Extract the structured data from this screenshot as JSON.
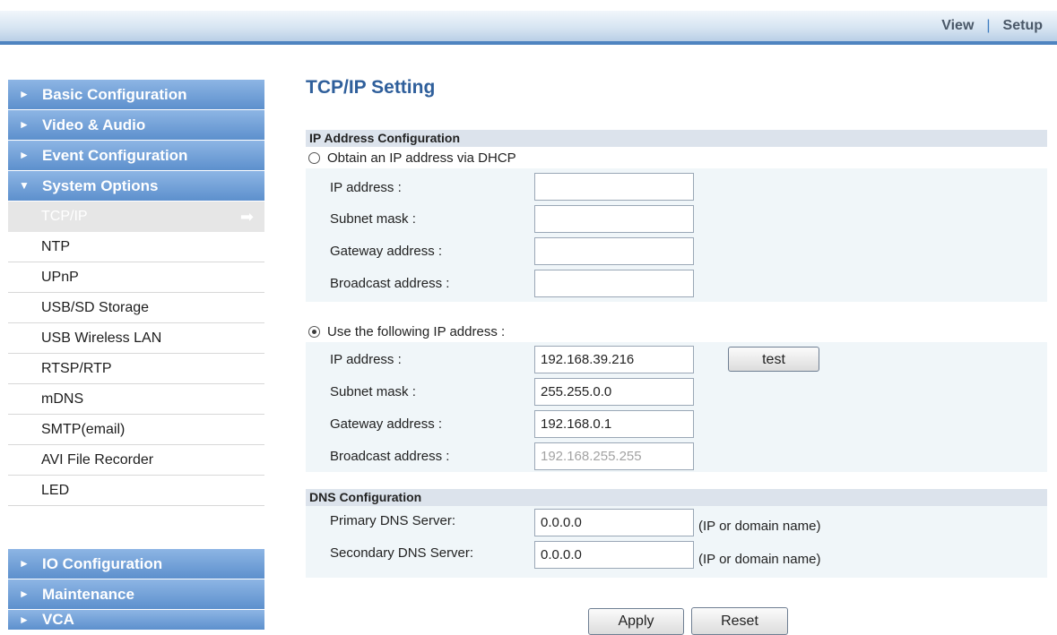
{
  "topnav": {
    "view": "View",
    "separator": "|",
    "setup": "Setup"
  },
  "sidebar": {
    "categories_top": [
      {
        "label": "Basic Configuration",
        "arrow": "►"
      },
      {
        "label": "Video & Audio",
        "arrow": "►"
      },
      {
        "label": "Event Configuration",
        "arrow": "►"
      },
      {
        "label": "System Options",
        "arrow": "▼"
      }
    ],
    "items": [
      {
        "label": "TCP/IP",
        "active": true,
        "arrow": "➡"
      },
      {
        "label": "NTP"
      },
      {
        "label": "UPnP"
      },
      {
        "label": "USB/SD Storage"
      },
      {
        "label": "USB Wireless LAN"
      },
      {
        "label": "RTSP/RTP"
      },
      {
        "label": "mDNS"
      },
      {
        "label": "SMTP(email)"
      },
      {
        "label": "AVI File Recorder"
      },
      {
        "label": "LED"
      }
    ],
    "categories_bottom": [
      {
        "label": "IO Configuration",
        "arrow": "►"
      },
      {
        "label": "Maintenance",
        "arrow": "►"
      },
      {
        "label": "VCA",
        "arrow": "►"
      }
    ]
  },
  "page": {
    "title": "TCP/IP Setting"
  },
  "ip_config": {
    "heading": "IP Address Configuration",
    "dhcp": {
      "label": "Obtain an IP address via DHCP",
      "selected": false,
      "ip_label": "IP address :",
      "ip_value": "",
      "mask_label": "Subnet mask :",
      "mask_value": "",
      "gateway_label": "Gateway address :",
      "gateway_value": "",
      "broadcast_label": "Broadcast address :",
      "broadcast_value": ""
    },
    "static": {
      "label": "Use the following IP address :",
      "selected": true,
      "ip_label": "IP address :",
      "ip_value": "192.168.39.216",
      "test_label": "test",
      "mask_label": "Subnet mask :",
      "mask_value": "255.255.0.0",
      "gateway_label": "Gateway address :",
      "gateway_value": "192.168.0.1",
      "broadcast_label": "Broadcast address :",
      "broadcast_value": "192.168.255.255"
    }
  },
  "dns_config": {
    "heading": "DNS Configuration",
    "primary_label": "Primary DNS Server:",
    "primary_value": "0.0.0.0",
    "primary_hint": "(IP or domain name)",
    "secondary_label": "Secondary DNS Server:",
    "secondary_value": "0.0.0.0",
    "secondary_hint": "(IP or domain name)"
  },
  "actions": {
    "apply": "Apply",
    "reset": "Reset"
  }
}
